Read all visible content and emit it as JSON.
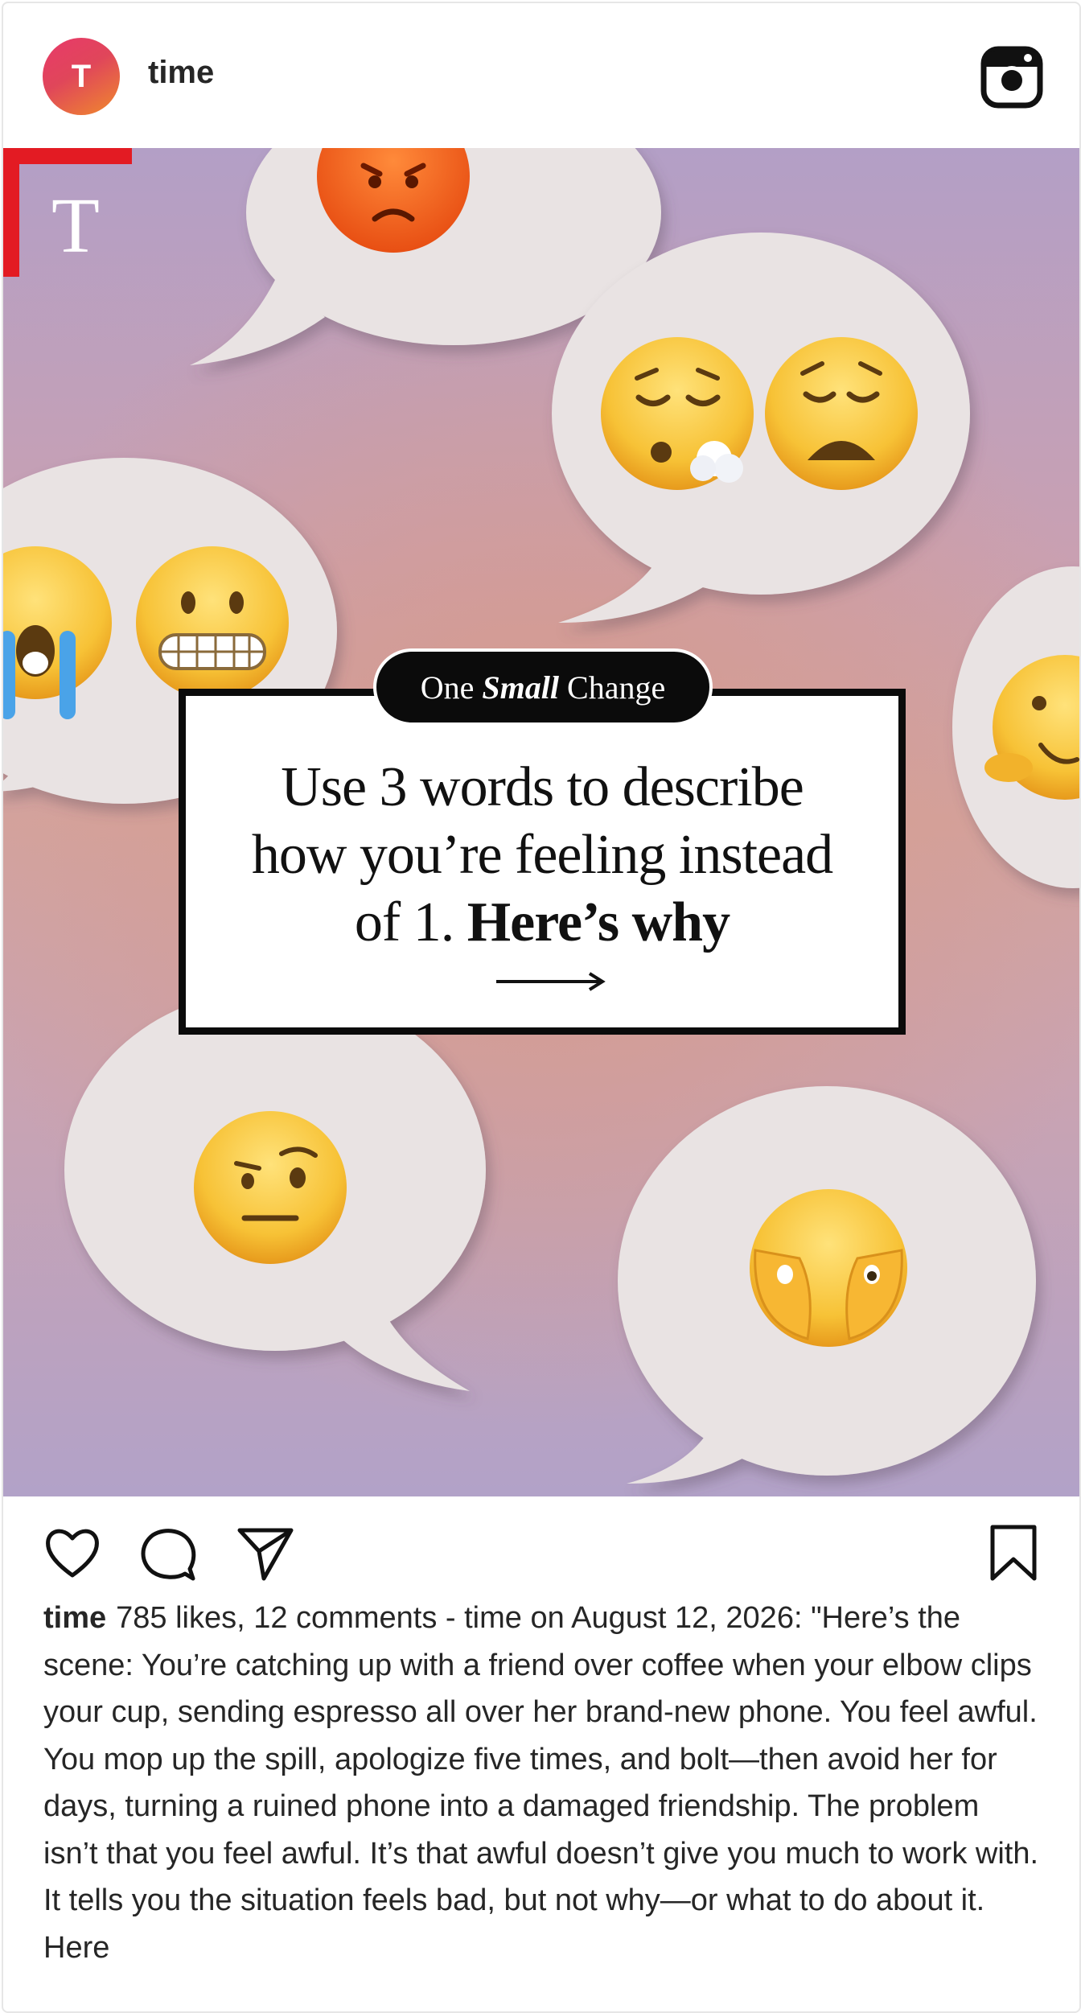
{
  "header": {
    "avatar_letter": "T",
    "username": "time",
    "platform_icon": "instagram-icon"
  },
  "post": {
    "logo_letter": "T",
    "series_label_pre": "One",
    "series_label_em": "Small",
    "series_label_post": "Change",
    "headline_line1": "Use 3 words to describe",
    "headline_line2": "how you’re feeling instead",
    "headline_line3_regular": "of 1.",
    "headline_line3_bold": "Here’s why",
    "emojis": [
      "angry-face-emoji",
      "sleepy-exhale-face-emoji",
      "weary-face-emoji",
      "crying-face-emoji",
      "grimacing-face-emoji",
      "melting-face-emoji",
      "raised-eyebrow-face-emoji",
      "peeking-face-emoji"
    ],
    "colors": {
      "accent_red": "#e31b23",
      "background_lavender": "#b39fc6",
      "background_peach": "#d69a8c"
    }
  },
  "actions": {
    "like_icon": "heart-icon",
    "comment_icon": "comment-icon",
    "share_icon": "send-icon",
    "save_icon": "bookmark-icon"
  },
  "caption": {
    "username": "time",
    "text": "785 likes, 12 comments - time on August 12, 2026: \"Here’s the scene: You’re catching up with a friend over coffee when your elbow clips your cup, sending espresso all over her brand-new phone. You feel awful. You mop up the spill, apologize five times, and bolt—then avoid her for days, turning a ruined phone into a damaged friendship. The problem isn’t that you feel awful. It’s that awful doesn’t give you much to work with. It tells you the situation feels bad, but not why—or what to do about it. Here"
  }
}
